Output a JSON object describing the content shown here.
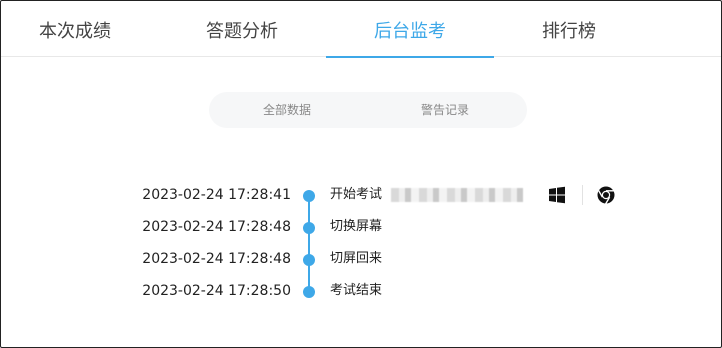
{
  "tabs": [
    {
      "label": "本次成绩",
      "active": false
    },
    {
      "label": "答题分析",
      "active": false
    },
    {
      "label": "后台监考",
      "active": true
    },
    {
      "label": "排行榜",
      "active": false
    }
  ],
  "segment": {
    "items": [
      {
        "label": "全部数据"
      },
      {
        "label": "警告记录"
      }
    ]
  },
  "timeline": {
    "events": [
      {
        "time": "2023-02-24 17:28:41",
        "label": "开始考试",
        "icons": [
          "windows-icon",
          "chrome-icon"
        ]
      },
      {
        "time": "2023-02-24 17:28:48",
        "label": "切换屏幕"
      },
      {
        "time": "2023-02-24 17:28:48",
        "label": "切屏回来"
      },
      {
        "time": "2023-02-24 17:28:50",
        "label": "考试结束"
      }
    ]
  },
  "colors": {
    "accent": "#3ea8e8",
    "text": "#222222",
    "muted": "#888888",
    "segment_bg": "#f6f7f8"
  }
}
